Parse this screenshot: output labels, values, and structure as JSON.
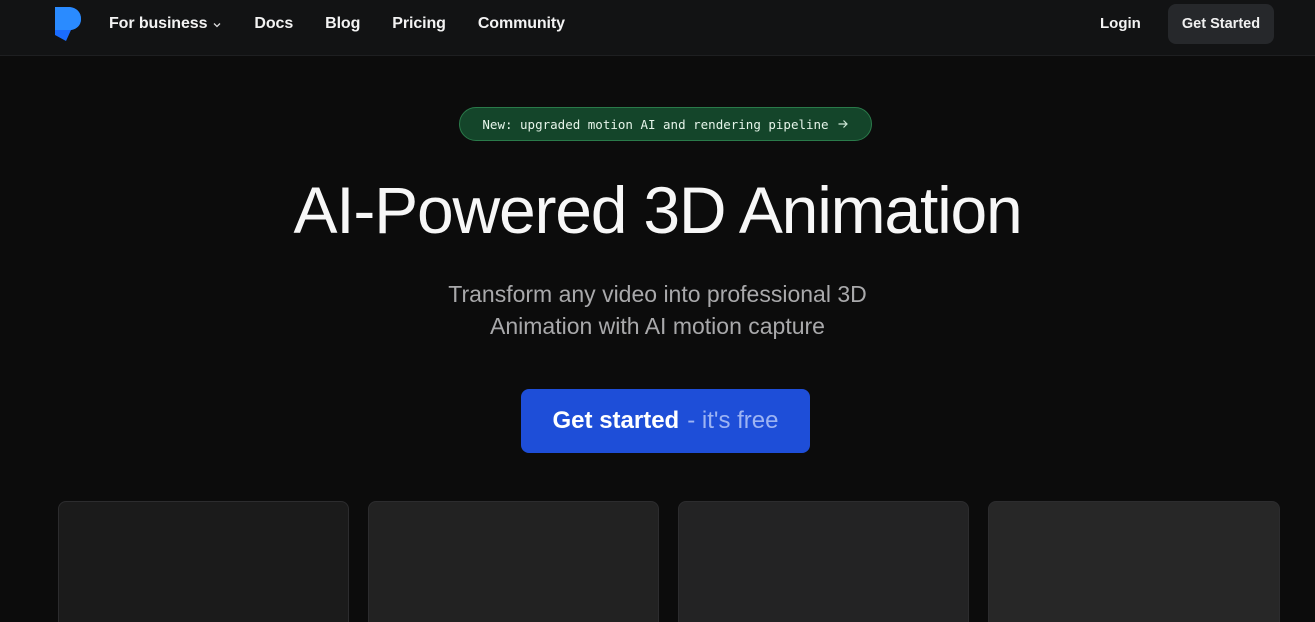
{
  "nav": {
    "logo_icon": "brand-logo-icon",
    "links": [
      {
        "label": "For business",
        "has_dropdown": true
      },
      {
        "label": "Docs"
      },
      {
        "label": "Blog"
      },
      {
        "label": "Pricing"
      },
      {
        "label": "Community"
      }
    ],
    "login_label": "Login",
    "cta_label": "Get Started"
  },
  "hero": {
    "announcement": "New: upgraded motion AI and rendering pipeline",
    "title": "AI-Powered 3D Animation",
    "subtitle_line1": "Transform any video into professional 3D",
    "subtitle_line2": "Animation with AI motion capture",
    "cta_primary": "Get started",
    "cta_secondary": "- it's free"
  },
  "colors": {
    "brand_blue": "#1e4ed8",
    "announce_green": "#14452a",
    "background": "#0c0c0c"
  }
}
